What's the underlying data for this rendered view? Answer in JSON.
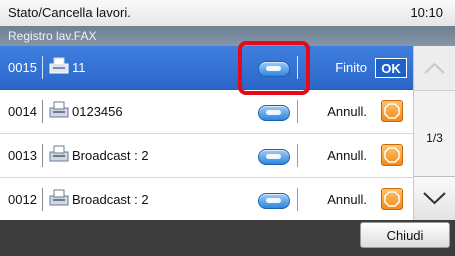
{
  "header": {
    "title": "Stato/Cancella lavori.",
    "time": "10:10"
  },
  "subheader": {
    "title": "Registro lav.FAX"
  },
  "jobs": [
    {
      "id": "0015",
      "destination": "11",
      "status": "Finito",
      "action_label": "OK",
      "selected": true
    },
    {
      "id": "0014",
      "destination": "0123456",
      "status": "Annull.",
      "action_icon": "stop-icon",
      "selected": false
    },
    {
      "id": "0013",
      "destination": "Broadcast : 2",
      "status": "Annull.",
      "action_icon": "stop-icon",
      "selected": false
    },
    {
      "id": "0012",
      "destination": "Broadcast : 2",
      "status": "Annull.",
      "action_icon": "stop-icon",
      "selected": false
    }
  ],
  "pagination": {
    "page": "1/3"
  },
  "footer": {
    "close_label": "Chiudi"
  },
  "colors": {
    "selected_row": "#2f6fd6",
    "highlight_box": "#e20b16",
    "ok_button": "#1d62c9",
    "stop_button": "#f28a1b"
  }
}
